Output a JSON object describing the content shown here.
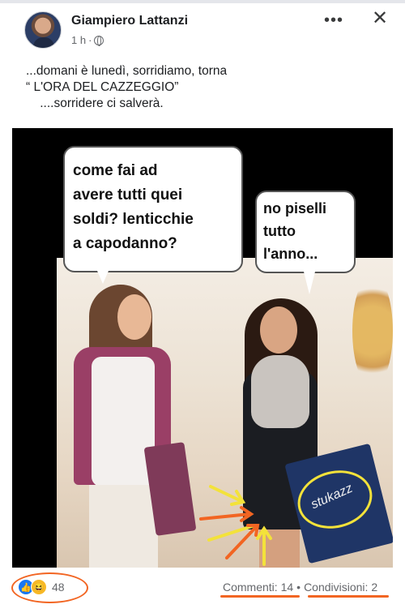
{
  "post": {
    "author": "Giampiero Lattanzi",
    "time": "1 h",
    "dot": "·",
    "more_label": "•••",
    "close_label": "✕",
    "caption": "...domani è lunedì, sorridiamo, torna\n“ L'ORA DEL CAZZEGGIO”\n    ....sorridere ci salverà."
  },
  "image": {
    "bubble_left": "come fai ad\navere tutti quei\nsoldi? lenticchie\na capodanno?",
    "bubble_right": "no piselli\ntutto\nl'anno...",
    "bag_text": "stukazz"
  },
  "footer": {
    "reactions_count": "48",
    "comments": "Commenti: 14",
    "separator": "•",
    "shares": "Condivisioni: 2"
  },
  "colors": {
    "annotation_orange": "#f26522",
    "annotation_yellow": "#f3e23a",
    "like_blue": "#1877f2"
  },
  "icons": {
    "privacy": "globe-icon",
    "reaction_like": "like-icon",
    "reaction_haha": "haha-icon",
    "menu": "more-icon",
    "close": "close-icon"
  }
}
